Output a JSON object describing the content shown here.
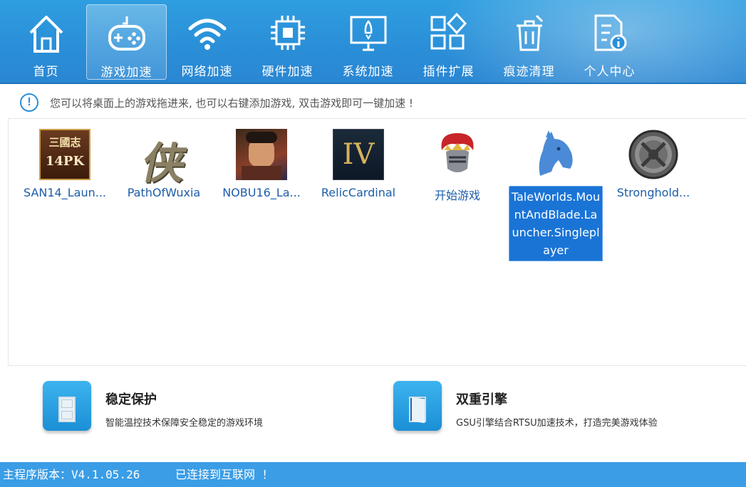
{
  "nav": {
    "items": [
      {
        "label": "首页",
        "icon": "home-icon"
      },
      {
        "label": "游戏加速",
        "icon": "gamepad-icon",
        "active": true
      },
      {
        "label": "网络加速",
        "icon": "wifi-icon"
      },
      {
        "label": "硬件加速",
        "icon": "chip-icon"
      },
      {
        "label": "系统加速",
        "icon": "monitor-rocket-icon"
      },
      {
        "label": "插件扩展",
        "icon": "plugin-icon"
      },
      {
        "label": "痕迹清理",
        "icon": "trash-icon"
      },
      {
        "label": "个人中心",
        "icon": "document-info-icon"
      }
    ]
  },
  "tip": {
    "icon": "exclamation-circle-icon",
    "text": "您可以将桌面上的游戏拖进来, 也可以右键添加游戏, 双击游戏即可一键加速 !"
  },
  "games": [
    {
      "name": "SAN14_Laun...",
      "icon": "san14-pk-icon",
      "icon_text_top": "三國志",
      "icon_text_bottom": "14PK"
    },
    {
      "name": "PathOfWuxia",
      "icon": "path-of-wuxia-icon",
      "icon_text": "侠"
    },
    {
      "name": "NOBU16_La...",
      "icon": "nobu16-portrait-icon"
    },
    {
      "name": "RelicCardinal",
      "icon": "relic-cardinal-icon",
      "icon_text": "IV"
    },
    {
      "name": "开始游戏",
      "icon": "knight-helmet-icon"
    },
    {
      "name": "TaleWorlds.MountAndBlade.Launcher.Singleplayer",
      "icon": "horse-head-icon",
      "selected": true
    },
    {
      "name": "Stronghold...",
      "icon": "stronghold-shield-icon"
    }
  ],
  "features": [
    {
      "title": "稳定保护",
      "desc": "智能温控技术保障安全稳定的游戏环境",
      "icon": "door-icon"
    },
    {
      "title": "双重引擎",
      "desc": "GSU引擎结合RTSU加速技术，打造完美游戏体验",
      "icon": "door-open-icon"
    }
  ],
  "status": {
    "version": "主程序版本：V4.1.05.26",
    "connection": "已连接到互联网 ！"
  },
  "colors": {
    "topbar": "#2a8fd8",
    "status_bar": "#3a9de6",
    "selection": "#1a74d6",
    "game_label": "#1d5da8"
  }
}
